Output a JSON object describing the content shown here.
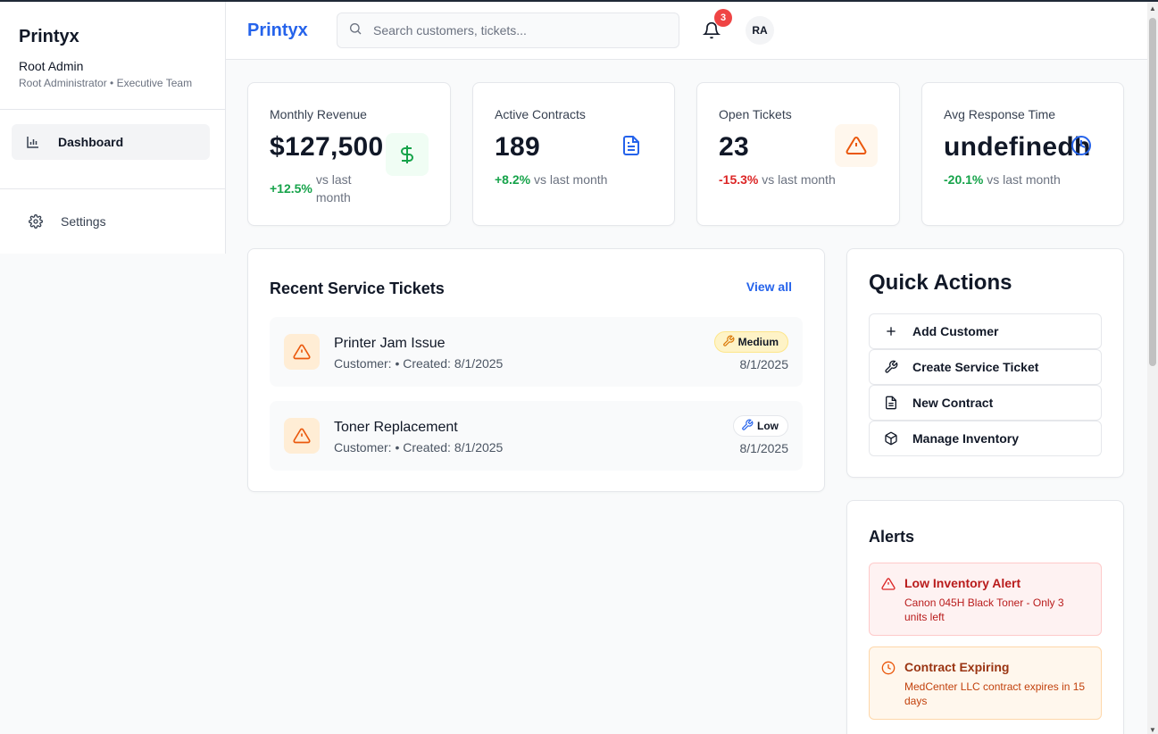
{
  "sidebar": {
    "brand": "Printyx",
    "user_name": "Root Admin",
    "user_role": "Root Administrator • Executive Team",
    "nav": [
      {
        "label": "Dashboard",
        "icon": "bar-chart-icon",
        "active": true
      }
    ],
    "footer": [
      {
        "label": "Settings",
        "icon": "gear-icon"
      }
    ]
  },
  "topbar": {
    "brand": "Printyx",
    "search_placeholder": "Search customers, tickets...",
    "notification_count": "3",
    "avatar_initials": "RA"
  },
  "stats": [
    {
      "label": "Monthly Revenue",
      "value": "$127,500",
      "change": "+12.5%",
      "change_suffix": "vs last month",
      "trend": "positive",
      "icon": "dollar-icon"
    },
    {
      "label": "Active Contracts",
      "value": "189",
      "change": "+8.2%",
      "change_suffix": "vs last month",
      "trend": "positive",
      "icon": "document-icon"
    },
    {
      "label": "Open Tickets",
      "value": "23",
      "change": "-15.3%",
      "change_suffix": "vs last month",
      "trend": "negative",
      "icon": "warning-icon"
    },
    {
      "label": "Avg Response Time",
      "value": "undefinedh",
      "change": "-20.1%",
      "change_suffix": "vs last month",
      "trend": "positive",
      "icon": "clock-icon"
    }
  ],
  "tickets": {
    "title": "Recent Service Tickets",
    "view_all": "View all",
    "items": [
      {
        "title": "Printer Jam Issue",
        "subtitle": "Customer: • Created: 8/1/2025",
        "priority": "Medium",
        "date": "8/1/2025"
      },
      {
        "title": "Toner Replacement",
        "subtitle": "Customer: • Created: 8/1/2025",
        "priority": "Low",
        "date": "8/1/2025"
      }
    ]
  },
  "quick_actions": {
    "title": "Quick Actions",
    "items": [
      {
        "label": "Add Customer",
        "icon": "plus-icon"
      },
      {
        "label": "Create Service Ticket",
        "icon": "wrench-icon"
      },
      {
        "label": "New Contract",
        "icon": "document-icon"
      },
      {
        "label": "Manage Inventory",
        "icon": "package-icon"
      }
    ]
  },
  "alerts": {
    "title": "Alerts",
    "items": [
      {
        "title": "Low Inventory Alert",
        "body": "Canon 045H Black Toner - Only 3 units left",
        "level": "red",
        "icon": "warning-icon"
      },
      {
        "title": "Contract Expiring",
        "body": "MedCenter LLC contract expires in 15 days",
        "level": "orange",
        "icon": "clock-icon"
      }
    ]
  },
  "colors": {
    "brand": "#2563eb",
    "positive": "#16a34a",
    "negative": "#dc2626",
    "badge": "#ef4444"
  }
}
